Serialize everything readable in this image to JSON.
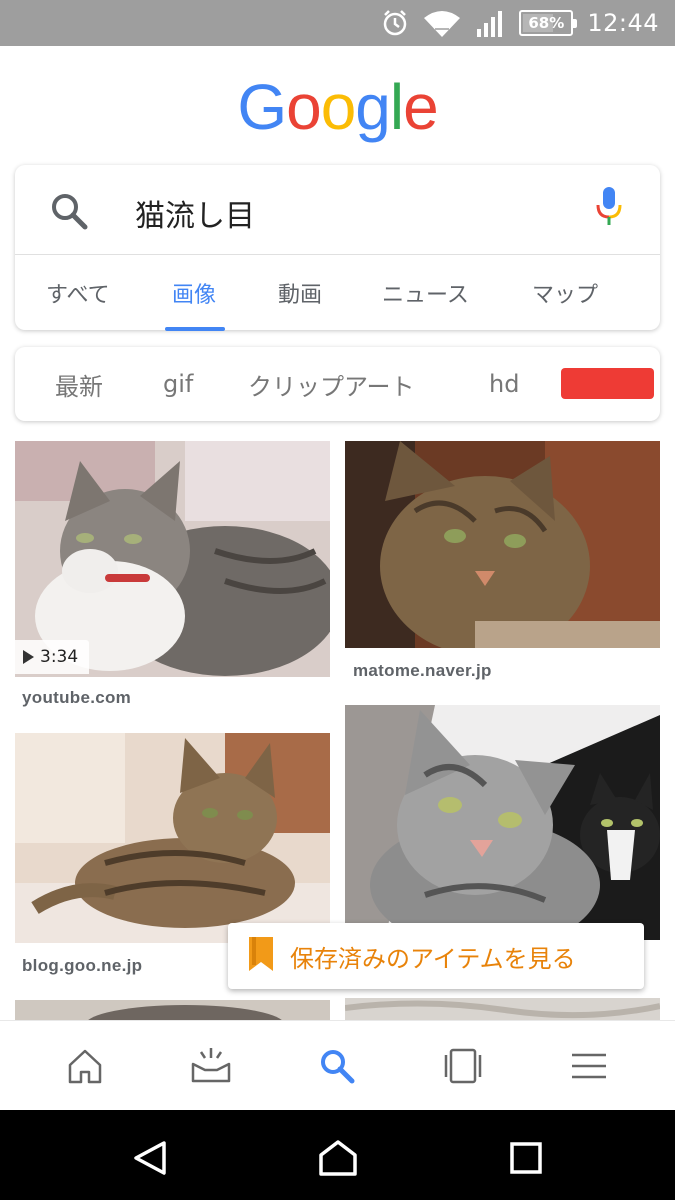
{
  "status_bar": {
    "battery": "68%",
    "battery_level": 0.68,
    "time": "12:44"
  },
  "logo": {
    "letters": [
      "G",
      "o",
      "o",
      "g",
      "l",
      "e"
    ],
    "colors": [
      "#4285f4",
      "#ea4335",
      "#fbbc05",
      "#4285f4",
      "#34a853",
      "#ea4335"
    ]
  },
  "search": {
    "query": "猫流し目"
  },
  "tabs": [
    {
      "label": "すべて",
      "active": false
    },
    {
      "label": "画像",
      "active": true
    },
    {
      "label": "動画",
      "active": false
    },
    {
      "label": "ニュース",
      "active": false
    },
    {
      "label": "マップ",
      "active": false
    }
  ],
  "filters": [
    {
      "label": "最新"
    },
    {
      "label": "gif"
    },
    {
      "label": "クリップアート"
    },
    {
      "label": "hd"
    }
  ],
  "results": [
    {
      "source": "youtube.com",
      "duration": "3:34"
    },
    {
      "source": "matome.naver.jp"
    },
    {
      "source": "blog.goo.ne.jp"
    },
    {
      "source": ""
    }
  ],
  "saved_button": {
    "label": "保存済みのアイテムを見る"
  },
  "colors": {
    "accent": "#4285f4",
    "saved_orange": "#e8830a",
    "chip_red": "#ee3b35",
    "status_bar": "#9e9e9e"
  },
  "bottom_nav": [
    "home-icon",
    "updates-icon",
    "search-icon",
    "tabs-icon",
    "menu-icon"
  ],
  "android_nav": [
    "back-icon",
    "home-icon",
    "recents-icon"
  ]
}
